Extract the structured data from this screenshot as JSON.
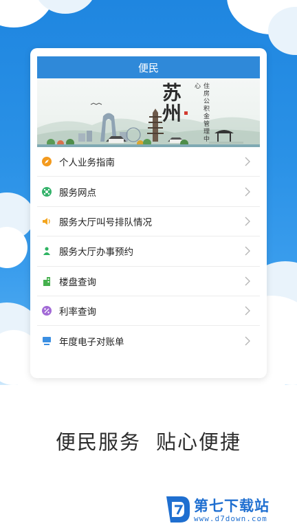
{
  "card": {
    "title": "便民",
    "banner": {
      "city_calligraphy": "苏州",
      "org_name": "住房公积金管理中心"
    }
  },
  "menu": [
    {
      "label": "个人业务指南",
      "icon": "compass-icon",
      "color": "#f39a1e"
    },
    {
      "label": "服务网点",
      "icon": "network-icon",
      "color": "#35b36b"
    },
    {
      "label": "服务大厅叫号排队情况",
      "icon": "speaker-icon",
      "color": "#f3a51e"
    },
    {
      "label": "服务大厅办事预约",
      "icon": "people-icon",
      "color": "#2fb463"
    },
    {
      "label": "楼盘查询",
      "icon": "building-icon",
      "color": "#45b04d"
    },
    {
      "label": "利率查询",
      "icon": "percent-icon",
      "color": "#a26ad6"
    },
    {
      "label": "年度电子对账单",
      "icon": "monitor-icon",
      "color": "#3b8fe2"
    }
  ],
  "slogan": {
    "left": "便民服务",
    "right": "贴心便捷"
  },
  "watermark": {
    "title": "第七下载站",
    "url": "www.d7down.com"
  },
  "colors": {
    "header_blue": "#2f89d9",
    "background_blue": "#2a91e6",
    "watermark_blue": "#1f6fd0"
  }
}
